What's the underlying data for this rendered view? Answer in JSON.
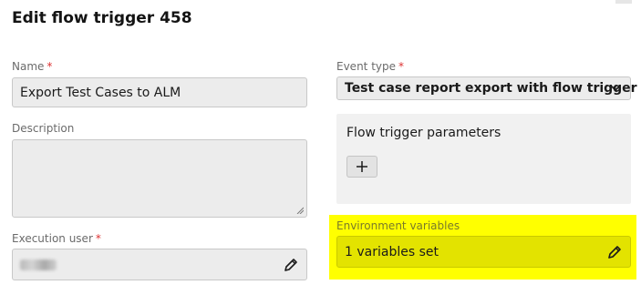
{
  "dialog": {
    "title": "Edit flow trigger 458"
  },
  "name": {
    "label": "Name",
    "required_mark": "*",
    "value": "Export Test Cases to ALM"
  },
  "description": {
    "label": "Description",
    "value": ""
  },
  "execution_user": {
    "label": "Execution user",
    "required_mark": "*"
  },
  "event_type": {
    "label": "Event type",
    "required_mark": "*",
    "selected": "Test case report export with flow trigger"
  },
  "flow_trigger_parameters": {
    "title": "Flow trigger parameters",
    "add_button_icon": "plus-icon"
  },
  "environment_variables": {
    "label": "Environment variables",
    "value": "1 variables set",
    "highlight_color": "#ffff00"
  },
  "colors": {
    "required": "#dd3333",
    "field_bg": "#ececec",
    "highlight": "#ffff00"
  }
}
